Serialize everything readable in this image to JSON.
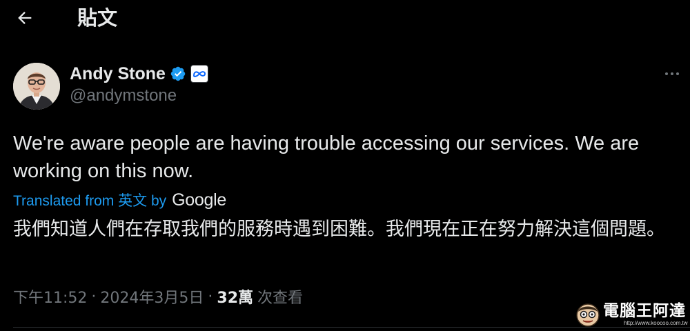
{
  "header": {
    "title": "貼文",
    "back_icon": "arrow-left-icon"
  },
  "author": {
    "display_name": "Andy Stone",
    "handle": "@andymstone",
    "verified_icon": "verified-badge-icon",
    "affiliation_icon": "meta-logo-icon",
    "verified_color": "#1d9bf0"
  },
  "tweet": {
    "text": "We're aware people are having trouble accessing our services. We are working on this now.",
    "translation_label_prefix": "Translated from",
    "translation_source_language": "英文",
    "translation_label_by": "by",
    "translation_provider": "Google",
    "translated_text": "我們知道人們在存取我們的服務時遇到困難。我們現在正在努力解決這個問題。"
  },
  "meta": {
    "time": "下午11:52",
    "separator": "·",
    "date": "2024年3月5日",
    "views_count": "32萬",
    "views_label": "次查看"
  },
  "watermark": {
    "title": "電腦王阿達",
    "url": "http://www.koocoo.com.tw"
  },
  "colors": {
    "background": "#000000",
    "text_primary": "#e7e9ea",
    "text_secondary": "#71767b",
    "link": "#1d9bf0",
    "divider": "#2f3336"
  }
}
